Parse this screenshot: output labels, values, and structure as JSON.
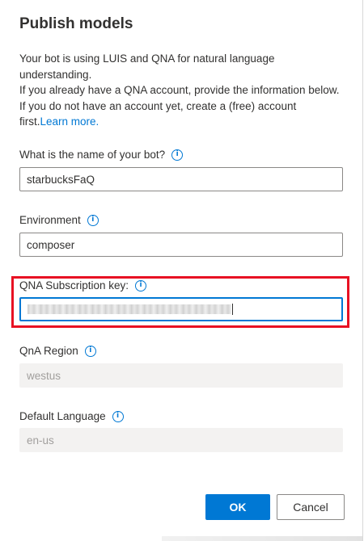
{
  "dialog": {
    "title": "Publish models",
    "description": {
      "line1": "Your bot is using LUIS and QNA for natural language understanding.",
      "line2": "If you already have a QNA account, provide the information below. If you do not have an account yet, create a (free) account first.",
      "link": "Learn more."
    },
    "fields": {
      "bot_name": {
        "label": "What is the name of your bot?",
        "value": "starbucksFaQ"
      },
      "environment": {
        "label": "Environment",
        "value": "composer"
      },
      "qna_key": {
        "label": "QNA Subscription key:",
        "value": ""
      },
      "region": {
        "label": "QnA Region",
        "value": "westus"
      },
      "language": {
        "label": "Default Language",
        "value": "en-us"
      }
    },
    "buttons": {
      "ok": "OK",
      "cancel": "Cancel"
    },
    "colors": {
      "accent": "#0078d4",
      "highlight": "#e81123"
    },
    "icons": {
      "info": "info-icon"
    }
  }
}
